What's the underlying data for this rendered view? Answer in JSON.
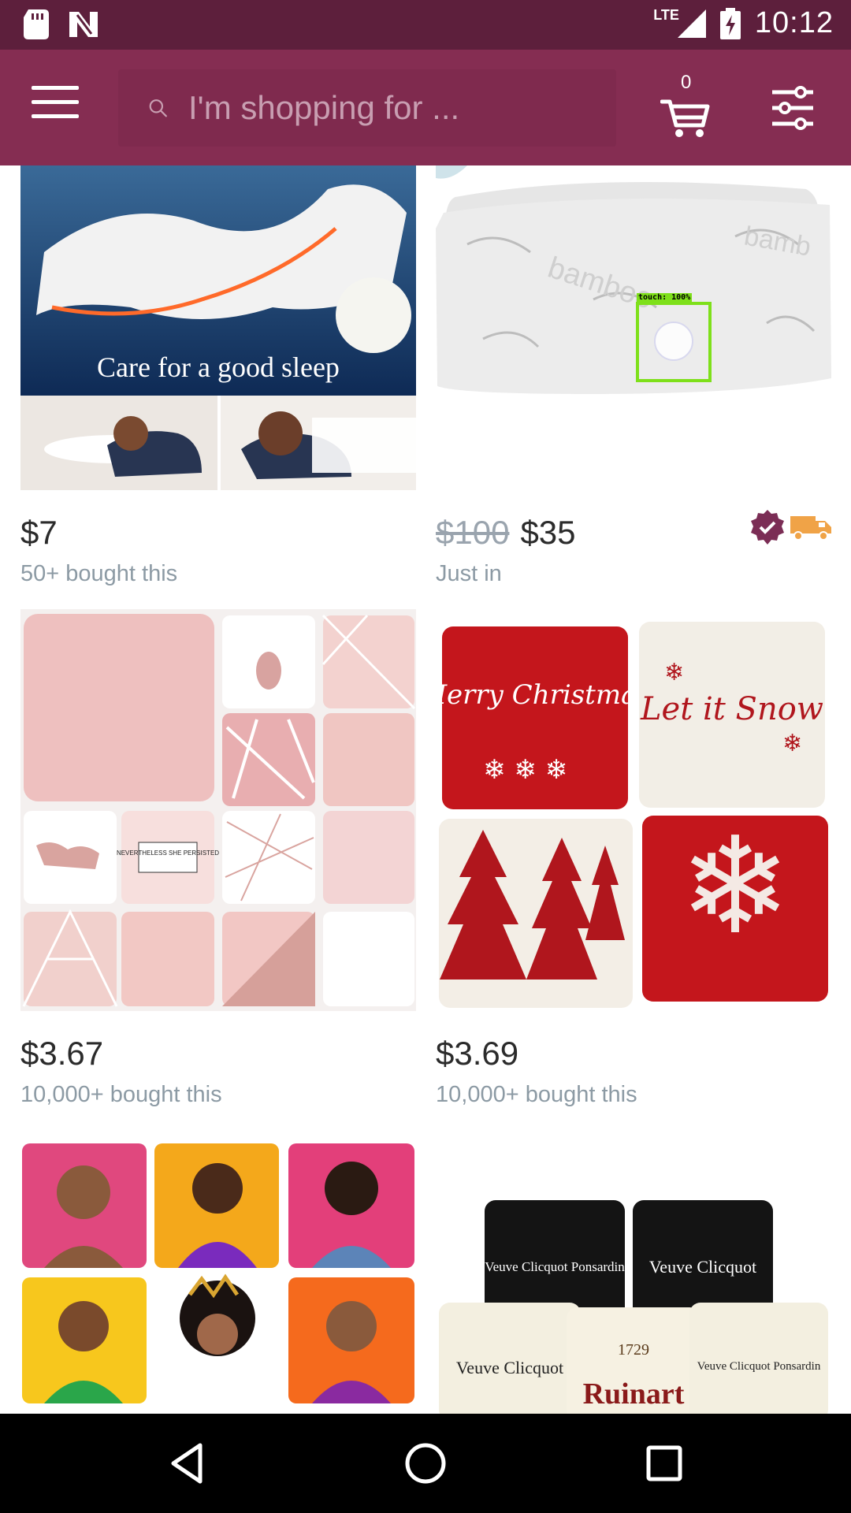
{
  "status_bar": {
    "network": "LTE",
    "time": "10:12",
    "icons": [
      "sd-card-icon",
      "notification-n-icon",
      "signal-icon",
      "battery-icon"
    ]
  },
  "app_bar": {
    "menu_icon": "hamburger-menu-icon",
    "search": {
      "placeholder": "I'm shopping for ..."
    },
    "cart": {
      "icon": "shopping-cart-icon",
      "count": "0"
    },
    "filter_icon": "filter-sliders-icon"
  },
  "products": [
    {
      "image_caption": "Care for a good sleep",
      "price": "$7",
      "subtitle": "50+ bought this"
    },
    {
      "old_price": "$100",
      "price": "$35",
      "subtitle": "Just in",
      "badges": [
        "verified-check-icon",
        "delivery-truck-icon"
      ]
    },
    {
      "price": "$3.67",
      "subtitle": "10,000+ bought this",
      "pillow_text": "NEVERTHELESS SHE PERSISTED"
    },
    {
      "price": "$3.69",
      "subtitle": "10,000+ bought this",
      "pillow_texts": [
        "Merry Christmas",
        "Let it Snow"
      ]
    },
    {
      "price": "",
      "subtitle": ""
    },
    {
      "price": "",
      "subtitle": "",
      "pillow_texts": [
        "Veuve Clicquot Ponsardin",
        "Veuve Clicquot",
        "Veuve Clicquot",
        "1729",
        "Ruinart",
        "Veuve Clicquot Ponsardin"
      ]
    }
  ],
  "touch_overlay": {
    "label": "touch: 100%"
  },
  "colors": {
    "status_bar": "#5d1f3c",
    "app_bar": "#852d52",
    "search_bg": "#7f2a4e",
    "price_text": "#2b2b2b",
    "subtitle_text": "#8c9aa4",
    "badge_purple": "#7b2d55",
    "truck_orange": "#f0a347"
  },
  "nav_bar": {
    "back_icon": "back-triangle-icon",
    "home_icon": "home-circle-icon",
    "recents_icon": "recents-square-icon"
  }
}
